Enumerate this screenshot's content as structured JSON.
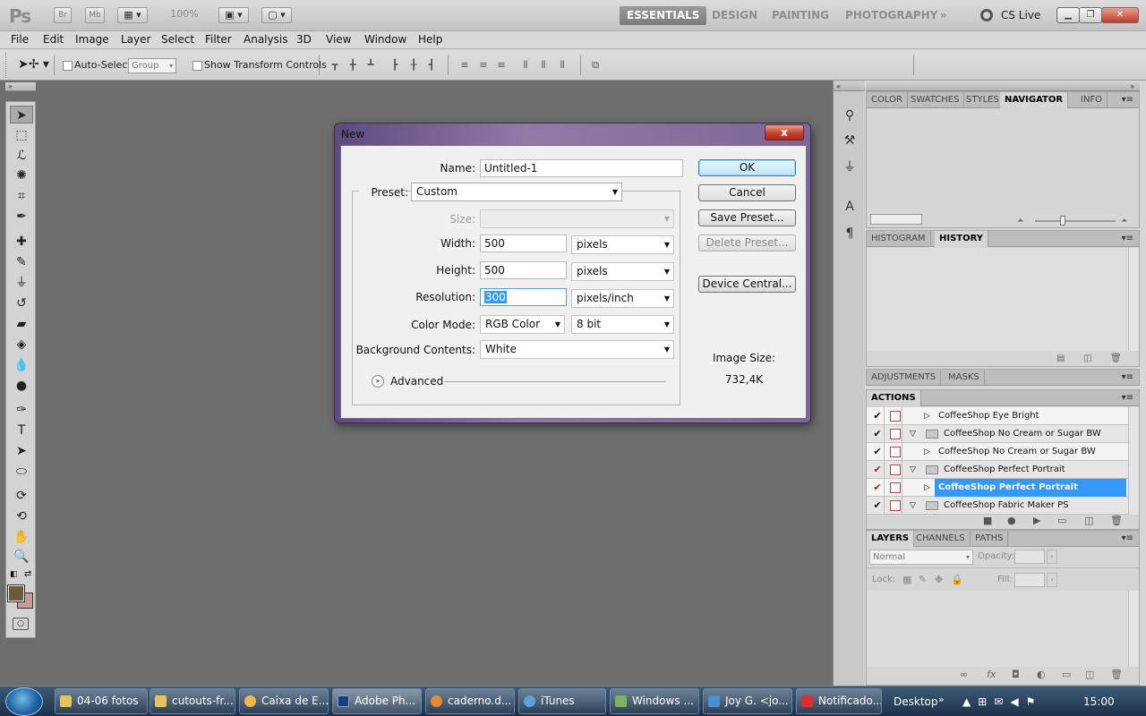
{
  "app": {
    "logo": "Ps",
    "bridge_btn": "Br",
    "minibridge_btn": "Mb",
    "zoom": "100%",
    "workspaces": [
      "ESSENTIALS",
      "DESIGN",
      "PAINTING",
      "PHOTOGRAPHY"
    ],
    "more": "»",
    "cslive": "CS Live"
  },
  "menus": [
    "File",
    "Edit",
    "Image",
    "Layer",
    "Select",
    "Filter",
    "Analysis",
    "3D",
    "View",
    "Window",
    "Help"
  ],
  "options": {
    "auto_select_label": "Auto-Select:",
    "group_value": "Group",
    "show_transform_label": "Show Transform Controls"
  },
  "panels": {
    "top_tabs": [
      "COLOR",
      "SWATCHES",
      "STYLES",
      "NAVIGATOR",
      "INFO"
    ],
    "top_active": "NAVIGATOR",
    "history_tabs": [
      "HISTOGRAM",
      "HISTORY"
    ],
    "history_active": "HISTORY",
    "adjust_tabs": [
      "ADJUSTMENTS",
      "MASKS"
    ],
    "actions_tab": "ACTIONS",
    "actions": [
      {
        "name": "CoffeeShop Eye Bright",
        "level": 1,
        "type": "action",
        "checked": true,
        "selected": false
      },
      {
        "name": "CoffeeShop No Cream or Sugar BW",
        "level": 0,
        "type": "set",
        "checked": true,
        "selected": false
      },
      {
        "name": "CoffeeShop No Cream or Sugar BW",
        "level": 1,
        "type": "action",
        "checked": true,
        "selected": false
      },
      {
        "name": "CoffeeShop Perfect Portrait",
        "level": 0,
        "type": "set",
        "checked": true,
        "selected": false
      },
      {
        "name": "CoffeeShop Perfect Portrait",
        "level": 1,
        "type": "action",
        "checked": true,
        "selected": true
      },
      {
        "name": "CoffeeShop Fabric Maker PS",
        "level": 0,
        "type": "set",
        "checked": true,
        "selected": false
      }
    ],
    "layers_tabs": [
      "LAYERS",
      "CHANNELS",
      "PATHS"
    ],
    "blend_mode": "Normal",
    "opacity_label": "Opacity:",
    "lock_label": "Lock:",
    "fill_label": "Fill:"
  },
  "dialog": {
    "title": "New",
    "close": "x",
    "name_label": "Name:",
    "name_value": "Untitled-1",
    "preset_label": "Preset:",
    "preset_value": "Custom",
    "size_label": "Size:",
    "width_label": "Width:",
    "width_value": "500",
    "width_unit": "pixels",
    "height_label": "Height:",
    "height_value": "500",
    "height_unit": "pixels",
    "resolution_label": "Resolution:",
    "resolution_value": "300",
    "resolution_unit": "pixels/inch",
    "color_mode_label": "Color Mode:",
    "color_mode_value": "RGB Color",
    "bit_depth": "8 bit",
    "bg_label": "Background Contents:",
    "bg_value": "White",
    "advanced": "Advanced",
    "ok": "OK",
    "cancel": "Cancel",
    "save_preset": "Save Preset...",
    "delete_preset": "Delete Preset...",
    "device_central": "Device Central...",
    "image_size_label": "Image Size:",
    "image_size_value": "732,4K"
  },
  "taskbar": {
    "items": [
      "04-06 fotos",
      "cutouts-fr...",
      "Caixa de E...",
      "Adobe Ph...",
      "caderno.d...",
      "iTunes",
      "Windows ...",
      "Joy G. <jo...",
      "Notificado..."
    ],
    "desktop": "Desktop",
    "clock": "15:00"
  },
  "colors": {
    "foreground": "#6b5a3c",
    "background": "#c99a9a",
    "selection": "#3399ff"
  }
}
